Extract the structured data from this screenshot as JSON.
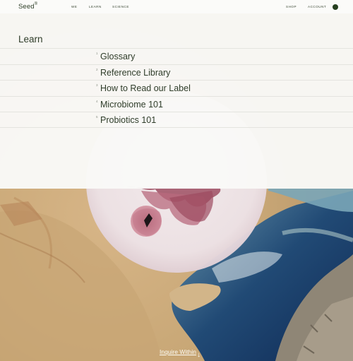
{
  "header": {
    "logo": "Seed",
    "logo_mark": "®",
    "nav": [
      "WE",
      "LEARN",
      "SCIENCE"
    ],
    "shop": "SHOP",
    "account": "ACCOUNT"
  },
  "learn_menu": {
    "title": "Learn",
    "items": [
      {
        "num": "1",
        "label": "Glossary"
      },
      {
        "num": "2",
        "label": "Reference Library"
      },
      {
        "num": "3",
        "label": "How to Read our Label"
      },
      {
        "num": "4",
        "label": "Microbiome 101"
      },
      {
        "num": "5",
        "label": "Probiotics 101"
      }
    ]
  },
  "footer": {
    "inquire": "Inquire Within",
    "arrow": "↓"
  },
  "colors": {
    "brand_green": "#26401f",
    "panel_bg": "#f9f9f7"
  }
}
